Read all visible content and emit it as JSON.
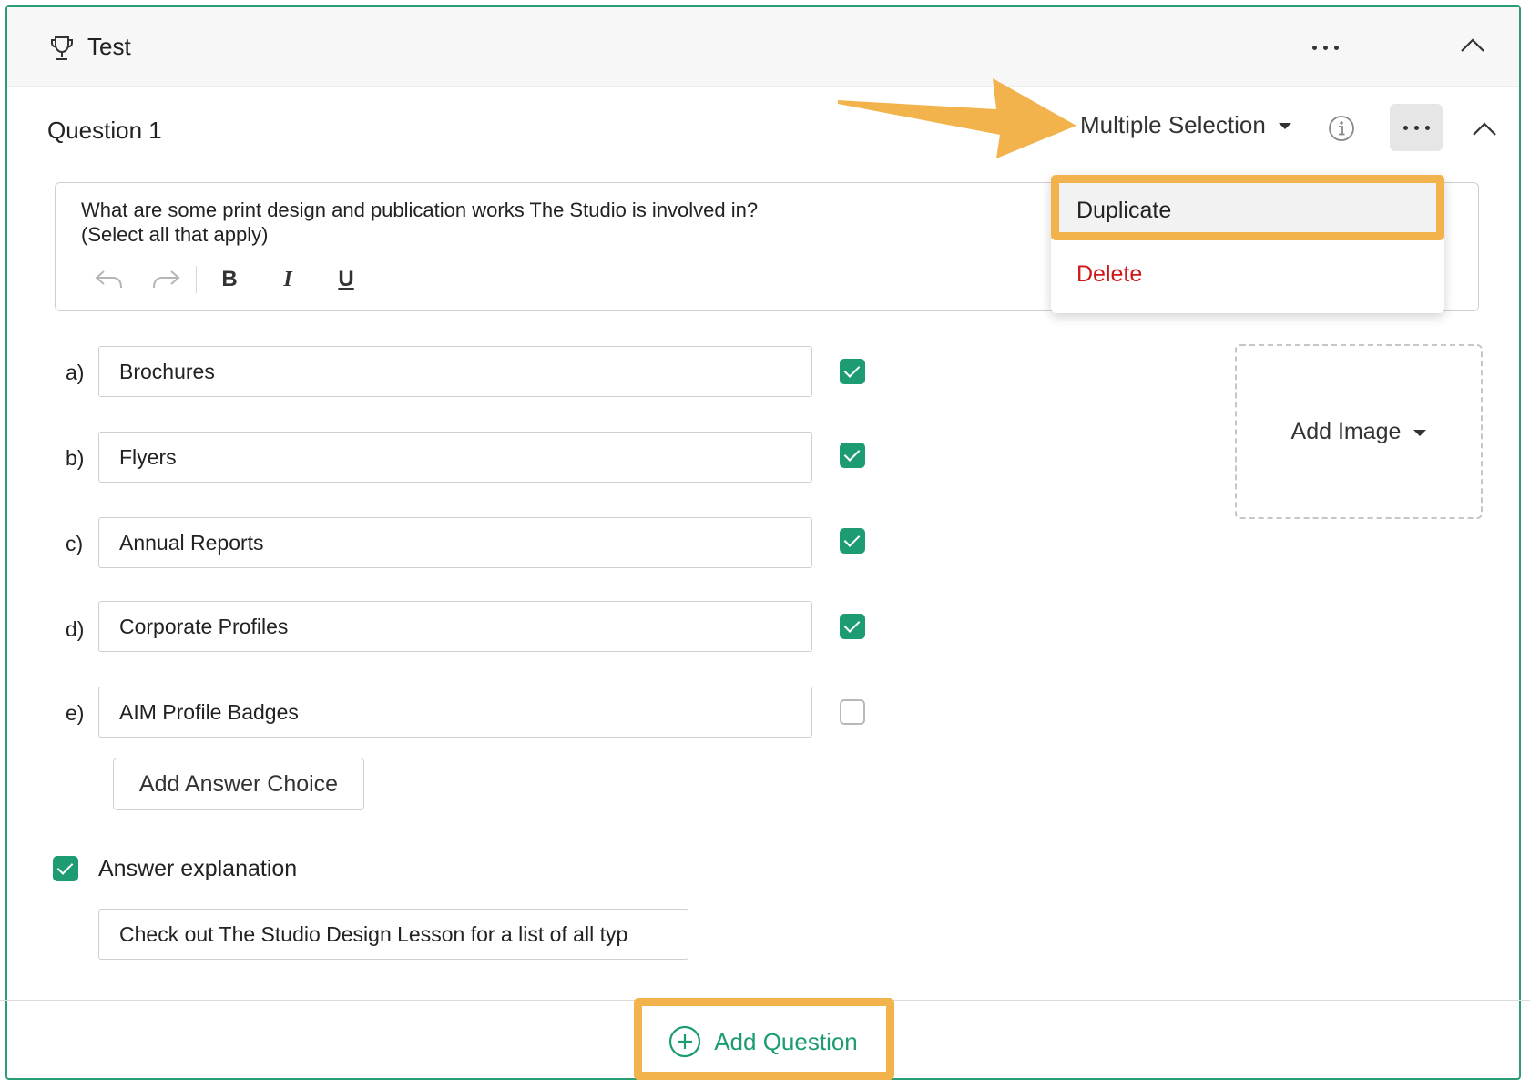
{
  "section": {
    "title": "Test"
  },
  "question": {
    "title": "Question 1",
    "type_label": "Multiple Selection",
    "prompt": "What are some print design and publication works The Studio is involved in?\n(Select all that apply)"
  },
  "menu": {
    "duplicate": "Duplicate",
    "delete": "Delete"
  },
  "choices": [
    {
      "letter": "a)",
      "text": "Brochures",
      "checked": true
    },
    {
      "letter": "b)",
      "text": "Flyers",
      "checked": true
    },
    {
      "letter": "c)",
      "text": "Annual Reports",
      "checked": true
    },
    {
      "letter": "d)",
      "text": "Corporate Profiles",
      "checked": true
    },
    {
      "letter": "e)",
      "text": "AIM Profile Badges",
      "checked": false
    }
  ],
  "add_image_label": "Add Image",
  "add_choice_label": "Add Answer Choice",
  "explanation": {
    "enabled": true,
    "label": "Answer explanation",
    "value": "Check out The Studio Design Lesson for a list of all typ"
  },
  "add_question_label": "Add Question",
  "colors": {
    "accent": "#1d9b73",
    "highlight": "#f2b34d",
    "danger": "#d0181b",
    "border": "#2a9d74"
  }
}
